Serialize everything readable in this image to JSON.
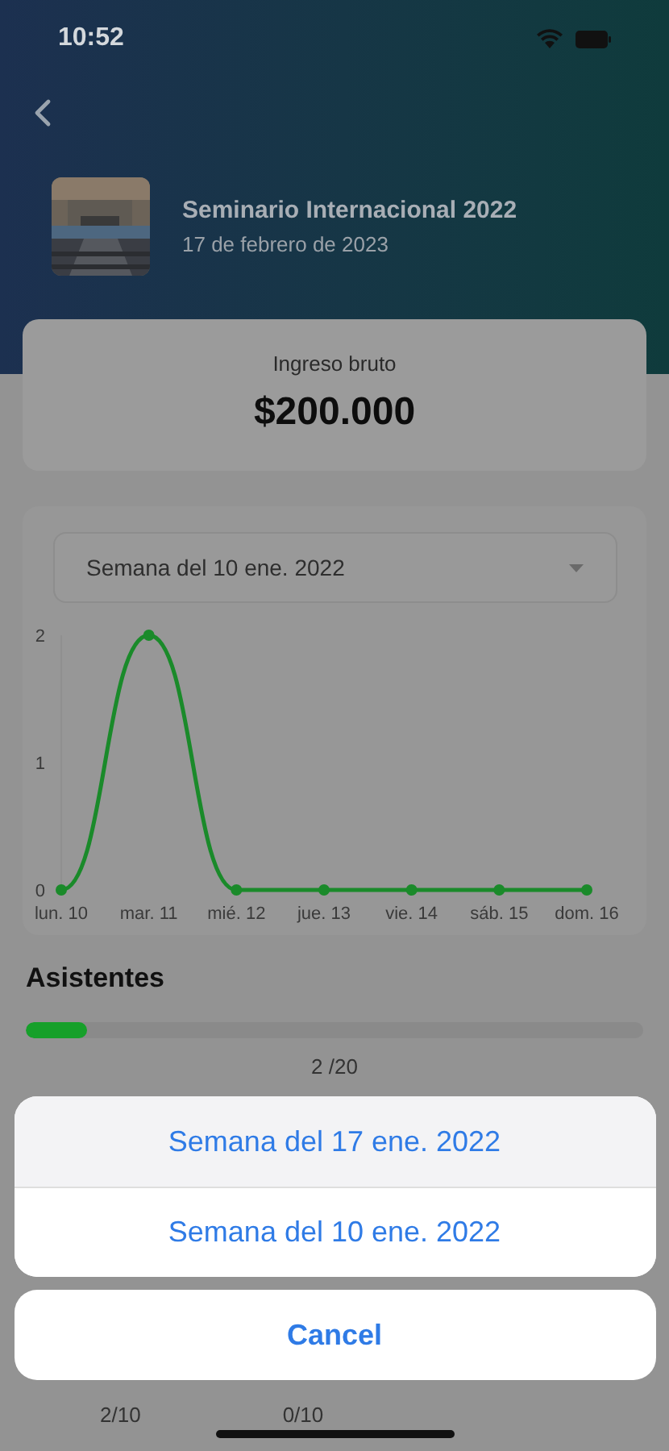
{
  "status_bar": {
    "time": "10:52"
  },
  "event": {
    "title": "Seminario Internacional 2022",
    "date": "17 de febrero de 2023"
  },
  "income": {
    "label": "Ingreso bruto",
    "amount": "$200.000"
  },
  "week_select": {
    "value": "Semana del 10 ene. 2022"
  },
  "chart_data": {
    "type": "line",
    "categories": [
      "lun. 10",
      "mar. 11",
      "mié. 12",
      "jue. 13",
      "vie. 14",
      "sáb. 15",
      "dom. 16"
    ],
    "yticks": [
      0,
      1,
      2
    ],
    "ylim": [
      0,
      2
    ],
    "series": [
      {
        "color": "#1a8a2a",
        "marker": "circle",
        "values": [
          0,
          2,
          0,
          0,
          0,
          0,
          0
        ]
      }
    ]
  },
  "attendees": {
    "title": "Asistentes",
    "level": 0.1,
    "reading": "2 /20"
  },
  "ticket_counts": [
    "2/10",
    "0/10"
  ],
  "action_sheet": {
    "options": [
      {
        "label": "Semana del 17 ene. 2022",
        "selected": true
      },
      {
        "label": "Semana del 10 ene. 2022",
        "selected": false
      }
    ],
    "cancel": "Cancel"
  }
}
